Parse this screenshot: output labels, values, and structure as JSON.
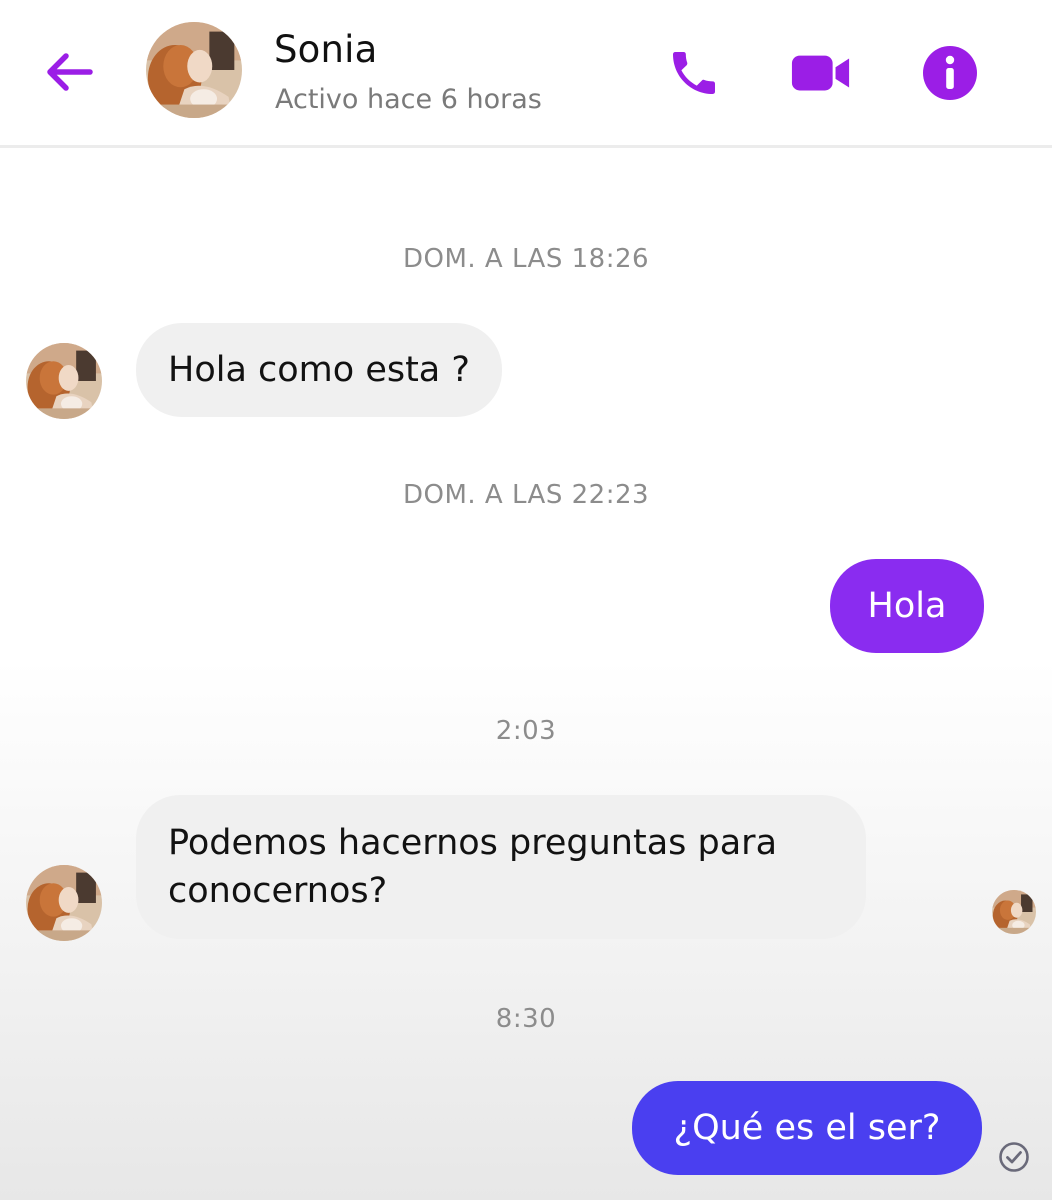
{
  "header": {
    "contact_name": "Sonia",
    "status": "Activo hace 6 horas",
    "back_icon": "arrow-left-icon",
    "call_icon": "phone-icon",
    "video_icon": "video-camera-icon",
    "info_icon": "info-icon"
  },
  "colors": {
    "accent": "#9b1ee6",
    "incoming_bubble": "#f0f0f0",
    "outgoing_bubble_1": "#8a2cf0",
    "outgoing_bubble_2": "#4a3ff0"
  },
  "conversation": {
    "timestamp_1": "DOM. A LAS 18:26",
    "msg_1": "Hola como esta ?",
    "timestamp_2": "DOM. A LAS 22:23",
    "msg_2": "Hola",
    "timestamp_3": "2:03",
    "msg_3_line_1": "Podemos hacernos preguntas para",
    "msg_3_line_2": "conocernos?",
    "timestamp_4": "8:30",
    "msg_4": "¿Qué es el ser?"
  }
}
